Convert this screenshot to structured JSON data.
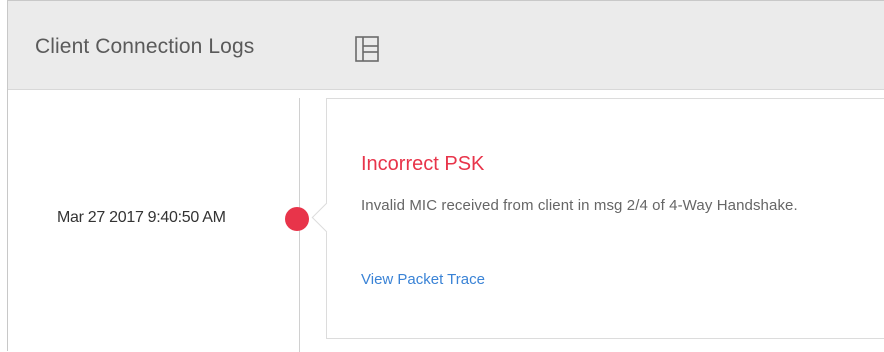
{
  "header": {
    "title": "Client Connection Logs",
    "layout_icon": "panel-layout-icon"
  },
  "timeline": {
    "events": [
      {
        "timestamp": "Mar 27 2017 9:40:50 AM",
        "status_color": "#e8344a",
        "title": "Incorrect PSK",
        "description": "Invalid MIC received from client in msg 2/4 of 4-Way Handshake.",
        "link_label": "View Packet Trace"
      }
    ]
  },
  "colors": {
    "error": "#e8344a",
    "link": "#3a83d6",
    "header_bg": "#ebebeb"
  }
}
